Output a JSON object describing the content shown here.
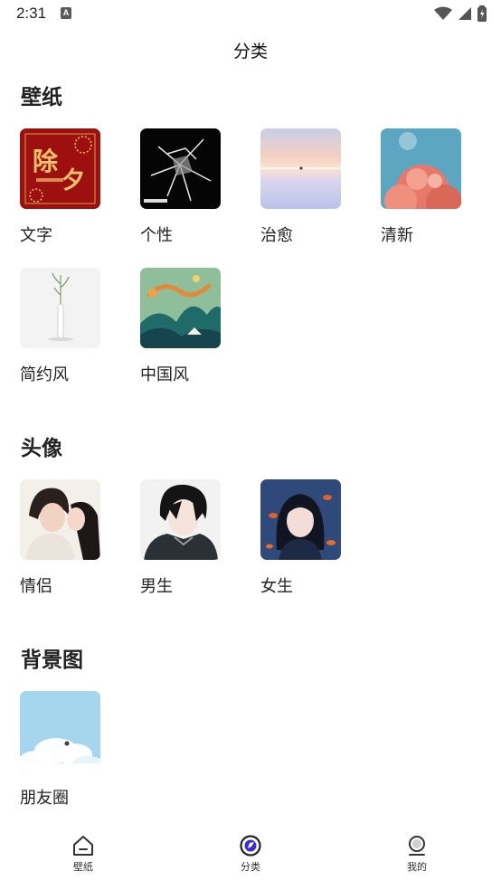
{
  "status": {
    "time": "2:31",
    "notification_badge": "A"
  },
  "header": {
    "title": "分类"
  },
  "sections": [
    {
      "title": "壁纸",
      "items": [
        {
          "label": "文字"
        },
        {
          "label": "个性"
        },
        {
          "label": "治愈"
        },
        {
          "label": "清新"
        },
        {
          "label": "简约风"
        },
        {
          "label": "中国风"
        }
      ]
    },
    {
      "title": "头像",
      "items": [
        {
          "label": "情侣"
        },
        {
          "label": "男生"
        },
        {
          "label": "女生"
        }
      ]
    },
    {
      "title": "背景图",
      "items": [
        {
          "label": "朋友圈"
        }
      ]
    }
  ],
  "nav": [
    {
      "label": "壁纸",
      "icon": "home-icon"
    },
    {
      "label": "分类",
      "icon": "compass-icon",
      "active": true
    },
    {
      "label": "我的",
      "icon": "profile-icon"
    }
  ],
  "colors": {
    "accent": "#3b2bd6",
    "text": "#222222"
  }
}
